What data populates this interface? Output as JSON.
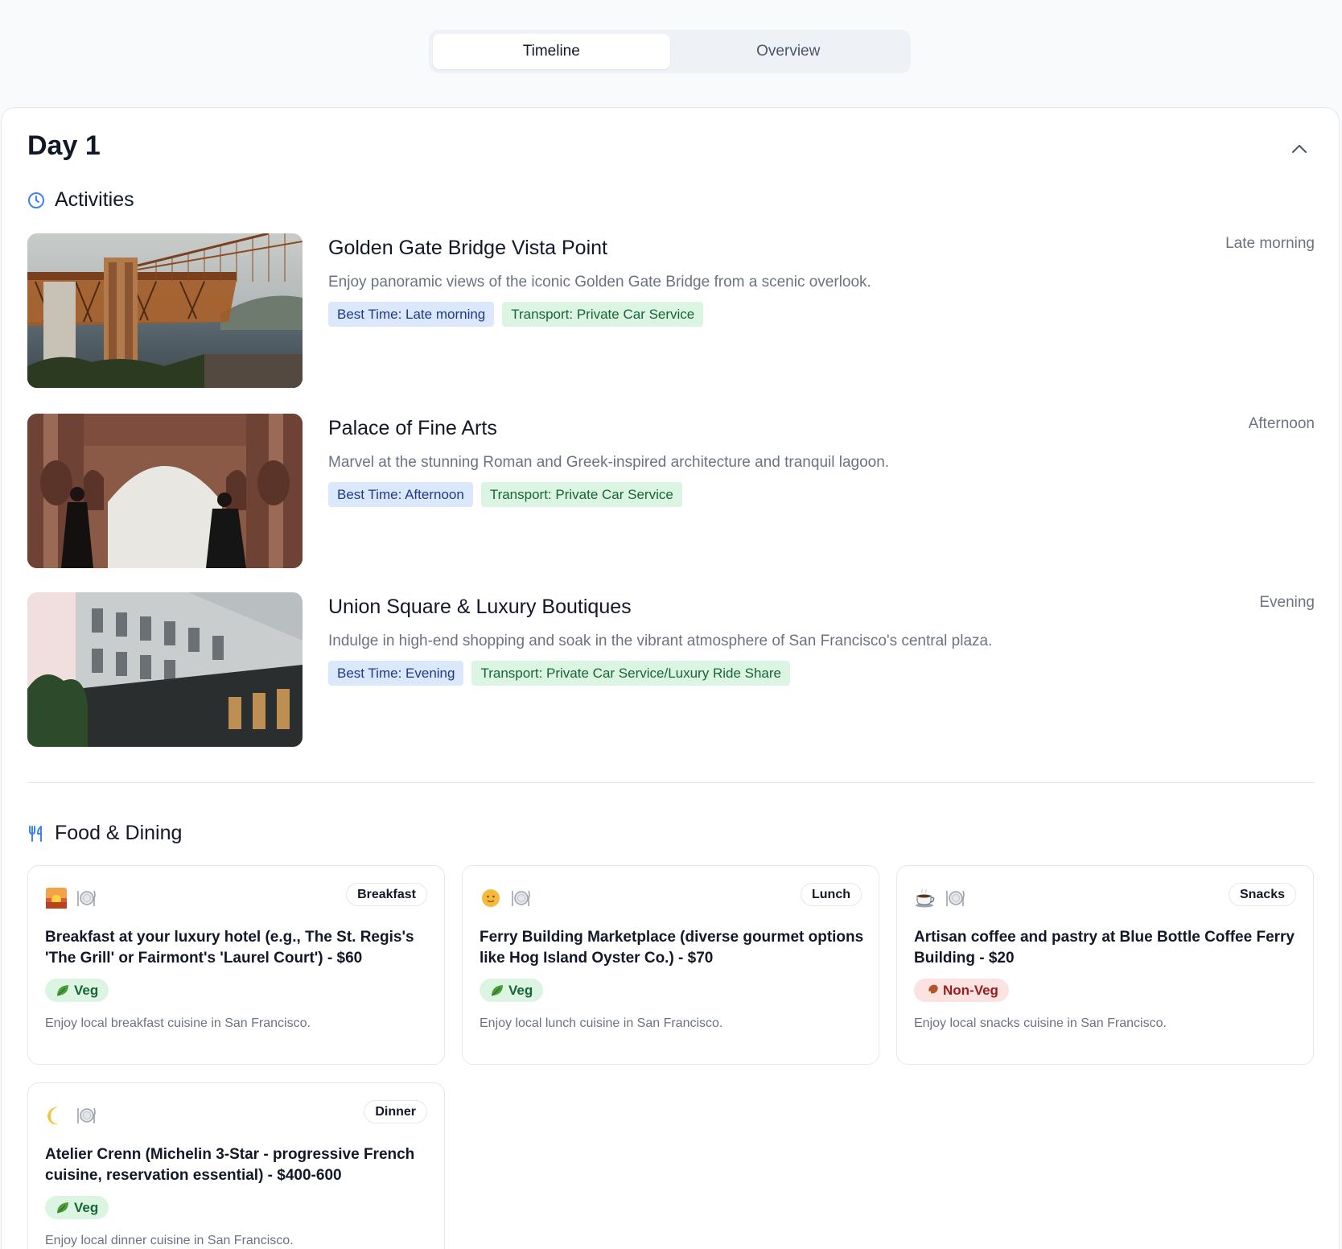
{
  "tabs": [
    {
      "label": "Timeline",
      "active": true
    },
    {
      "label": "Overview",
      "active": false
    }
  ],
  "day": {
    "title": "Day 1"
  },
  "activities_section": {
    "label": "Activities",
    "icon": "clock-icon"
  },
  "activities": [
    {
      "title": "Golden Gate Bridge Vista Point",
      "time": "Late morning",
      "description": "Enjoy panoramic views of the iconic Golden Gate Bridge from a scenic overlook.",
      "best_time": "Best Time: Late morning",
      "transport": "Transport: Private Car Service",
      "image": "golden-gate-bridge-photo"
    },
    {
      "title": "Palace of Fine Arts",
      "time": "Afternoon",
      "description": "Marvel at the stunning Roman and Greek-inspired architecture and tranquil lagoon.",
      "best_time": "Best Time: Afternoon",
      "transport": "Transport: Private Car Service",
      "image": "palace-of-fine-arts-photo"
    },
    {
      "title": "Union Square & Luxury Boutiques",
      "time": "Evening",
      "description": "Indulge in high-end shopping and soak in the vibrant atmosphere of San Francisco's central plaza.",
      "best_time": "Best Time: Evening",
      "transport": "Transport: Private Car Service/Luxury Ride Share",
      "image": "union-square-photo"
    }
  ],
  "food_section": {
    "label": "Food & Dining",
    "icon": "utensils-icon"
  },
  "meals": [
    {
      "meal": "Breakfast",
      "emoji": "sunrise-icon",
      "title": "Breakfast at your luxury hotel (e.g., The St. Regis's 'The Grill' or Fairmont's 'Laurel Court') - $60",
      "diet": "Veg",
      "description": "Enjoy local breakfast cuisine in San Francisco."
    },
    {
      "meal": "Lunch",
      "emoji": "sun-icon",
      "title": "Ferry Building Marketplace (diverse gourmet options like Hog Island Oyster Co.) - $70",
      "diet": "Veg",
      "description": "Enjoy local lunch cuisine in San Francisco."
    },
    {
      "meal": "Snacks",
      "emoji": "coffee-icon",
      "title": "Artisan coffee and pastry at Blue Bottle Coffee Ferry Building - $20",
      "diet": "Non-Veg",
      "description": "Enjoy local snacks cuisine in San Francisco."
    },
    {
      "meal": "Dinner",
      "emoji": "moon-icon",
      "title": "Atelier Crenn (Michelin 3-Star - progressive French cuisine, reservation essential) - $400-600",
      "diet": "Veg",
      "description": "Enjoy local dinner cuisine in San Francisco."
    }
  ],
  "colors": {
    "accent": "#3b82f6",
    "veg_bg": "#dcf5e3",
    "nonveg_bg": "#fde2e2",
    "best_time_bg": "#dbe7fb"
  }
}
